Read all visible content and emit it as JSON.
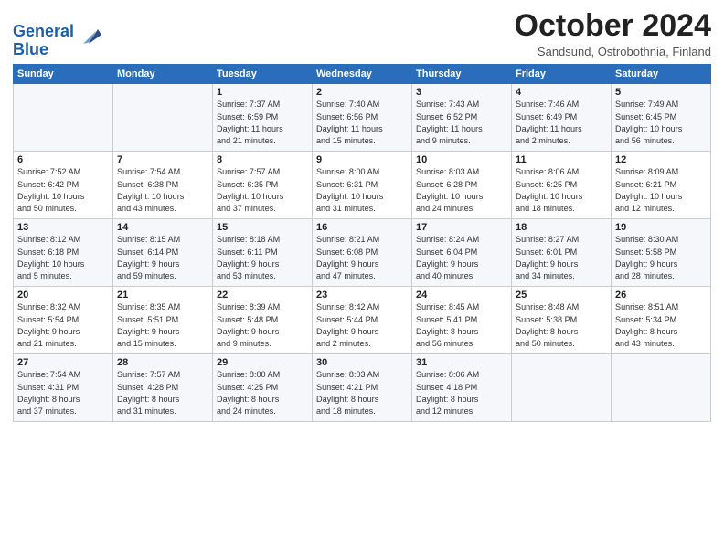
{
  "header": {
    "logo_line1": "General",
    "logo_line2": "Blue",
    "month": "October 2024",
    "location": "Sandsund, Ostrobothnia, Finland"
  },
  "weekdays": [
    "Sunday",
    "Monday",
    "Tuesday",
    "Wednesday",
    "Thursday",
    "Friday",
    "Saturday"
  ],
  "weeks": [
    [
      {
        "day": "",
        "info": ""
      },
      {
        "day": "",
        "info": ""
      },
      {
        "day": "1",
        "info": "Sunrise: 7:37 AM\nSunset: 6:59 PM\nDaylight: 11 hours\nand 21 minutes."
      },
      {
        "day": "2",
        "info": "Sunrise: 7:40 AM\nSunset: 6:56 PM\nDaylight: 11 hours\nand 15 minutes."
      },
      {
        "day": "3",
        "info": "Sunrise: 7:43 AM\nSunset: 6:52 PM\nDaylight: 11 hours\nand 9 minutes."
      },
      {
        "day": "4",
        "info": "Sunrise: 7:46 AM\nSunset: 6:49 PM\nDaylight: 11 hours\nand 2 minutes."
      },
      {
        "day": "5",
        "info": "Sunrise: 7:49 AM\nSunset: 6:45 PM\nDaylight: 10 hours\nand 56 minutes."
      }
    ],
    [
      {
        "day": "6",
        "info": "Sunrise: 7:52 AM\nSunset: 6:42 PM\nDaylight: 10 hours\nand 50 minutes."
      },
      {
        "day": "7",
        "info": "Sunrise: 7:54 AM\nSunset: 6:38 PM\nDaylight: 10 hours\nand 43 minutes."
      },
      {
        "day": "8",
        "info": "Sunrise: 7:57 AM\nSunset: 6:35 PM\nDaylight: 10 hours\nand 37 minutes."
      },
      {
        "day": "9",
        "info": "Sunrise: 8:00 AM\nSunset: 6:31 PM\nDaylight: 10 hours\nand 31 minutes."
      },
      {
        "day": "10",
        "info": "Sunrise: 8:03 AM\nSunset: 6:28 PM\nDaylight: 10 hours\nand 24 minutes."
      },
      {
        "day": "11",
        "info": "Sunrise: 8:06 AM\nSunset: 6:25 PM\nDaylight: 10 hours\nand 18 minutes."
      },
      {
        "day": "12",
        "info": "Sunrise: 8:09 AM\nSunset: 6:21 PM\nDaylight: 10 hours\nand 12 minutes."
      }
    ],
    [
      {
        "day": "13",
        "info": "Sunrise: 8:12 AM\nSunset: 6:18 PM\nDaylight: 10 hours\nand 5 minutes."
      },
      {
        "day": "14",
        "info": "Sunrise: 8:15 AM\nSunset: 6:14 PM\nDaylight: 9 hours\nand 59 minutes."
      },
      {
        "day": "15",
        "info": "Sunrise: 8:18 AM\nSunset: 6:11 PM\nDaylight: 9 hours\nand 53 minutes."
      },
      {
        "day": "16",
        "info": "Sunrise: 8:21 AM\nSunset: 6:08 PM\nDaylight: 9 hours\nand 47 minutes."
      },
      {
        "day": "17",
        "info": "Sunrise: 8:24 AM\nSunset: 6:04 PM\nDaylight: 9 hours\nand 40 minutes."
      },
      {
        "day": "18",
        "info": "Sunrise: 8:27 AM\nSunset: 6:01 PM\nDaylight: 9 hours\nand 34 minutes."
      },
      {
        "day": "19",
        "info": "Sunrise: 8:30 AM\nSunset: 5:58 PM\nDaylight: 9 hours\nand 28 minutes."
      }
    ],
    [
      {
        "day": "20",
        "info": "Sunrise: 8:32 AM\nSunset: 5:54 PM\nDaylight: 9 hours\nand 21 minutes."
      },
      {
        "day": "21",
        "info": "Sunrise: 8:35 AM\nSunset: 5:51 PM\nDaylight: 9 hours\nand 15 minutes."
      },
      {
        "day": "22",
        "info": "Sunrise: 8:39 AM\nSunset: 5:48 PM\nDaylight: 9 hours\nand 9 minutes."
      },
      {
        "day": "23",
        "info": "Sunrise: 8:42 AM\nSunset: 5:44 PM\nDaylight: 9 hours\nand 2 minutes."
      },
      {
        "day": "24",
        "info": "Sunrise: 8:45 AM\nSunset: 5:41 PM\nDaylight: 8 hours\nand 56 minutes."
      },
      {
        "day": "25",
        "info": "Sunrise: 8:48 AM\nSunset: 5:38 PM\nDaylight: 8 hours\nand 50 minutes."
      },
      {
        "day": "26",
        "info": "Sunrise: 8:51 AM\nSunset: 5:34 PM\nDaylight: 8 hours\nand 43 minutes."
      }
    ],
    [
      {
        "day": "27",
        "info": "Sunrise: 7:54 AM\nSunset: 4:31 PM\nDaylight: 8 hours\nand 37 minutes."
      },
      {
        "day": "28",
        "info": "Sunrise: 7:57 AM\nSunset: 4:28 PM\nDaylight: 8 hours\nand 31 minutes."
      },
      {
        "day": "29",
        "info": "Sunrise: 8:00 AM\nSunset: 4:25 PM\nDaylight: 8 hours\nand 24 minutes."
      },
      {
        "day": "30",
        "info": "Sunrise: 8:03 AM\nSunset: 4:21 PM\nDaylight: 8 hours\nand 18 minutes."
      },
      {
        "day": "31",
        "info": "Sunrise: 8:06 AM\nSunset: 4:18 PM\nDaylight: 8 hours\nand 12 minutes."
      },
      {
        "day": "",
        "info": ""
      },
      {
        "day": "",
        "info": ""
      }
    ]
  ]
}
